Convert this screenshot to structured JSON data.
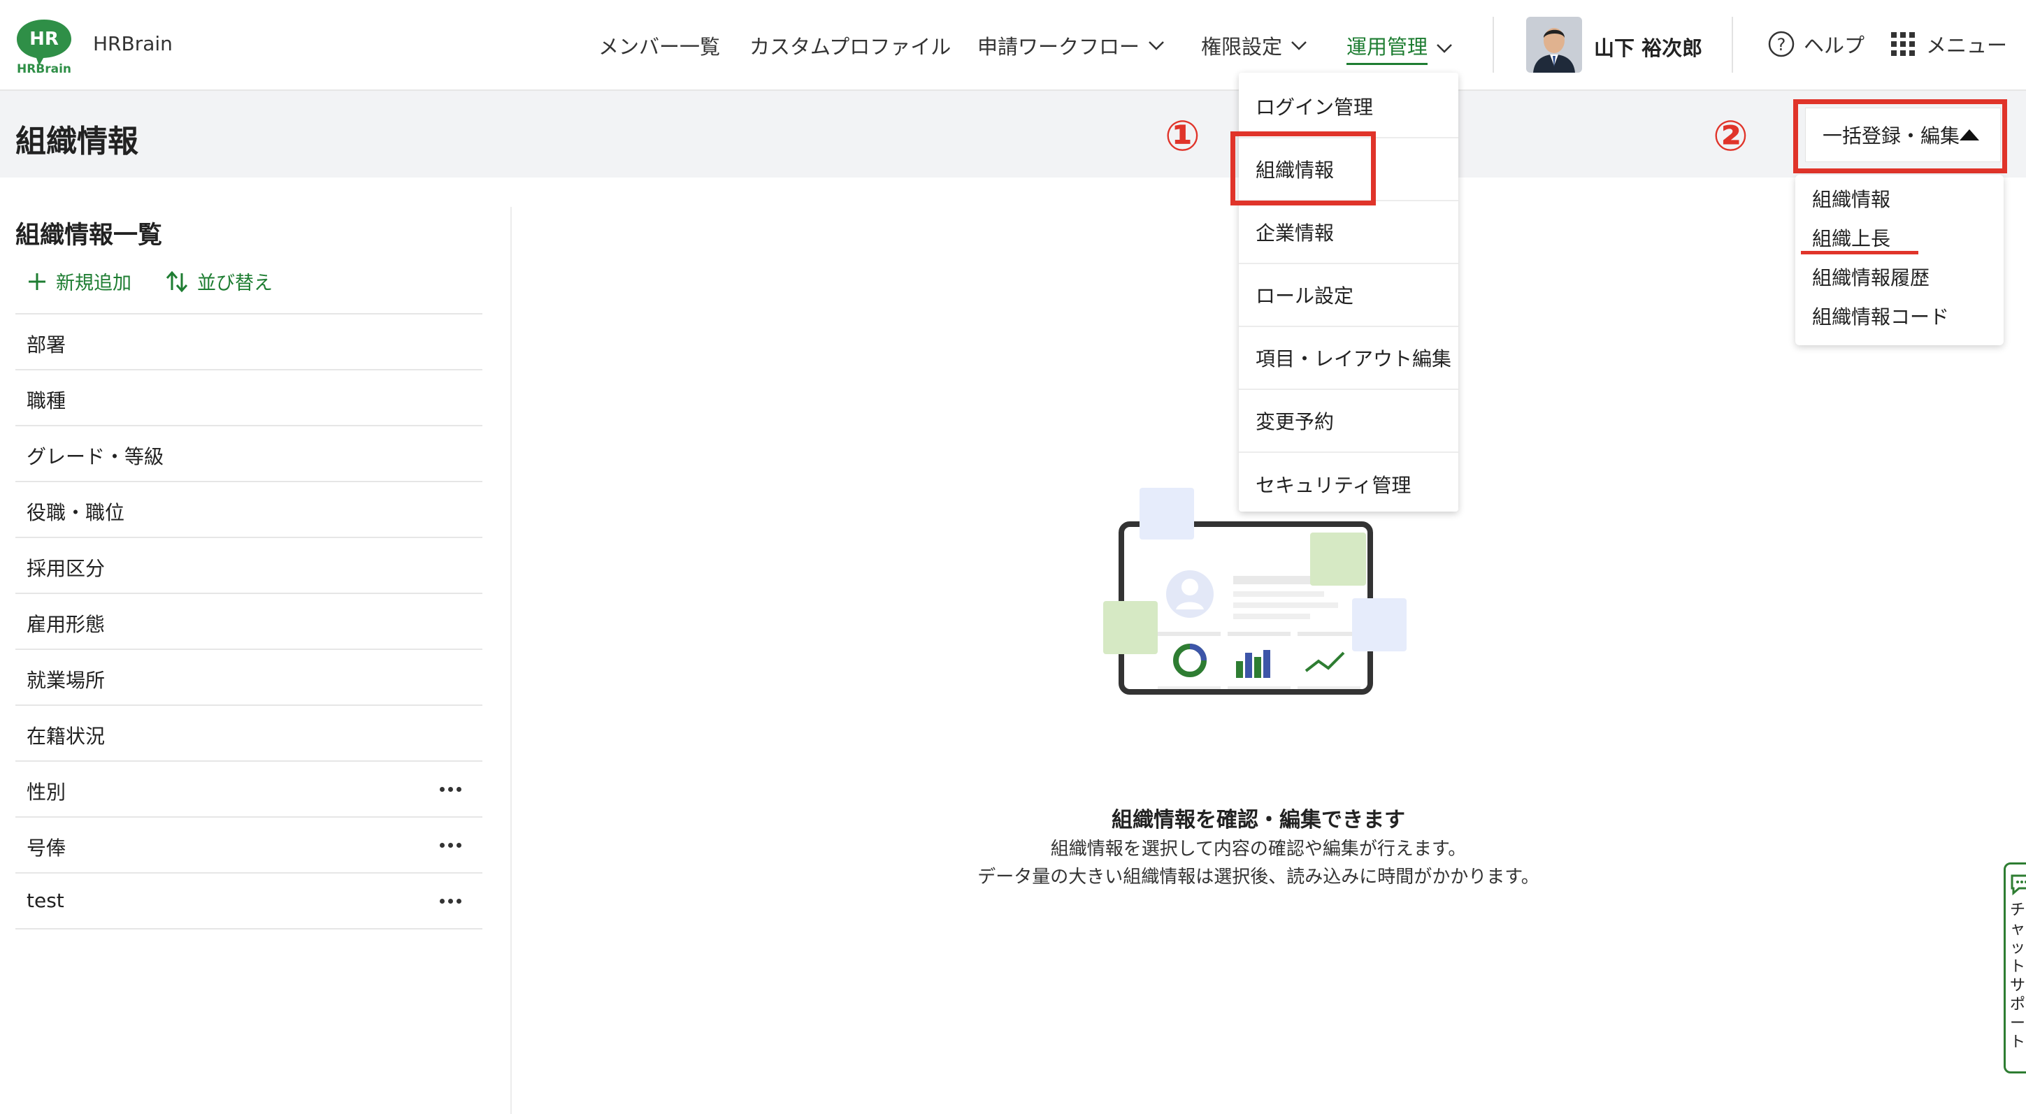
{
  "header": {
    "logo_text": "HR",
    "logo_subtext": "HRBrain",
    "app_name": "HRBrain",
    "nav": [
      {
        "label": "メンバー一覧"
      },
      {
        "label": "カスタムプロファイル"
      },
      {
        "label": "申請ワークフロー"
      },
      {
        "label": "権限設定"
      },
      {
        "label": "運用管理"
      }
    ],
    "user_name": "山下 裕次郎",
    "help_label": "ヘルプ",
    "menu_label": "メニュー"
  },
  "ops_menu": {
    "items": [
      "ログイン管理",
      "組織情報",
      "企業情報",
      "ロール設定",
      "項目・レイアウト編集",
      "変更予約",
      "セキュリティ管理"
    ]
  },
  "page": {
    "title": "組織情報",
    "bulk_button_label": "一括登録・編集",
    "bulk_menu": [
      "組織情報",
      "組織上長",
      "組織情報履歴",
      "組織情報コード"
    ]
  },
  "annotations": {
    "marker_1": "①",
    "marker_2": "②"
  },
  "sidebar": {
    "title": "組織情報一覧",
    "add_label": "新規追加",
    "sort_label": "並び替え",
    "items": [
      {
        "label": "部署"
      },
      {
        "label": "職種"
      },
      {
        "label": "グレード・等級"
      },
      {
        "label": "役職・職位"
      },
      {
        "label": "採用区分"
      },
      {
        "label": "雇用形態"
      },
      {
        "label": "就業場所"
      },
      {
        "label": "在籍状況"
      },
      {
        "label": "性別"
      },
      {
        "label": "号俸"
      },
      {
        "label": "test"
      }
    ]
  },
  "empty_state": {
    "heading": "組織情報を確認・編集できます",
    "line1": "組織情報を選択して内容の確認や編集が行えます。",
    "line2": "データ量の大きい組織情報は選択後、読み込みに時間がかかります。"
  },
  "chat": {
    "label": "チャットサポート"
  },
  "colors": {
    "accent_green": "#1e7d32",
    "annotation_red": "#e0342a",
    "title_band": "#f2f3f5"
  }
}
